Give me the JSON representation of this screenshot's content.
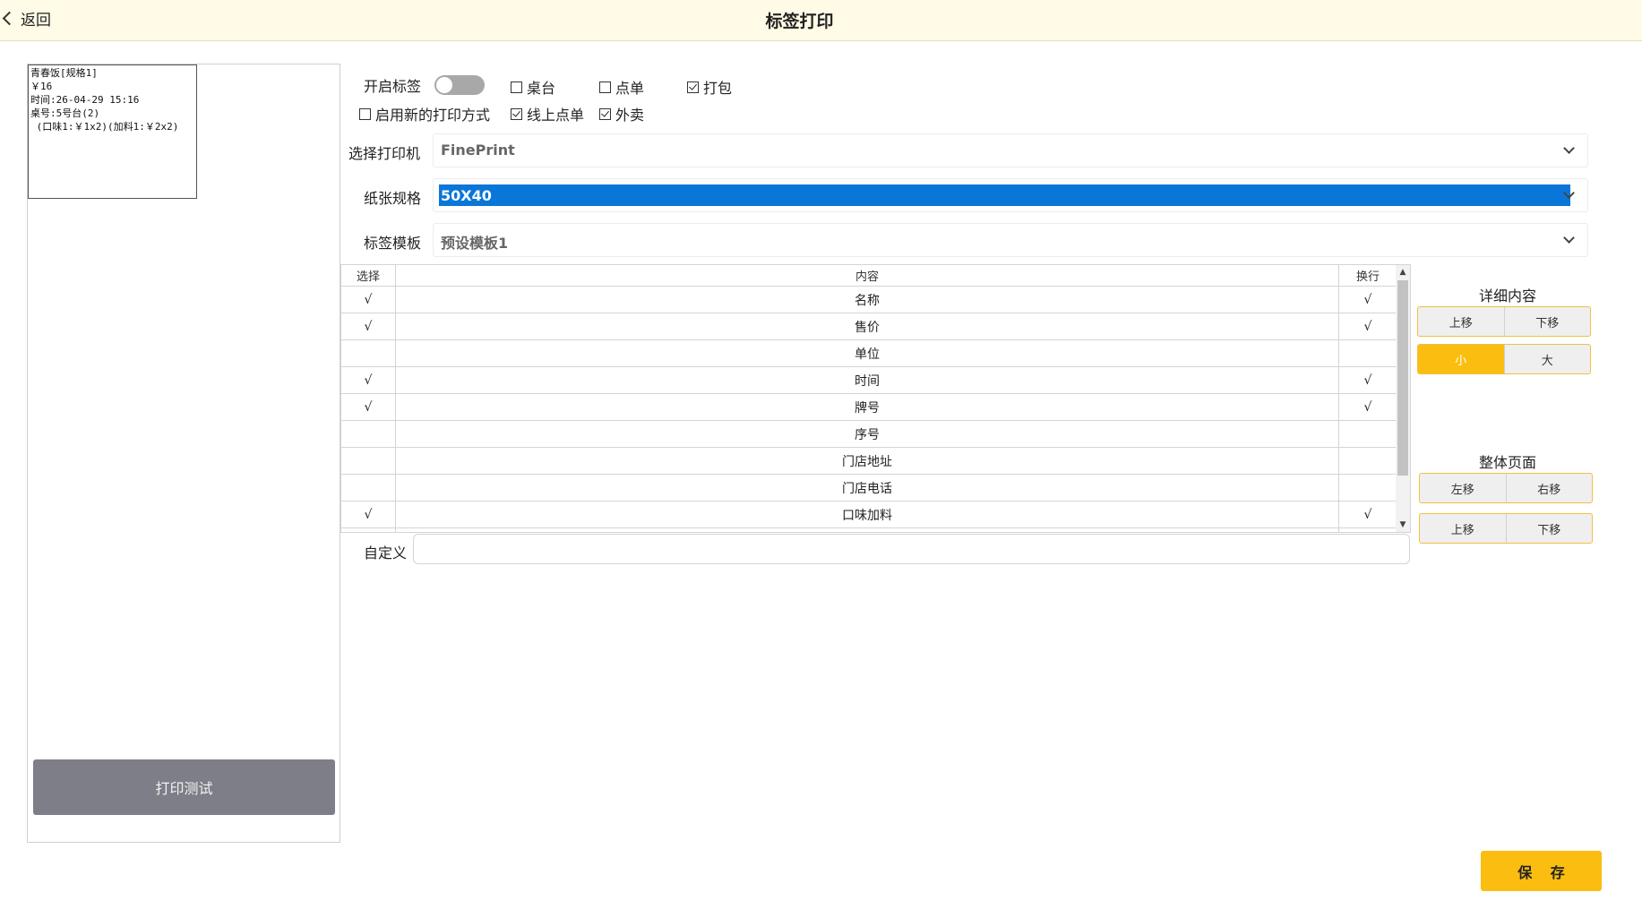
{
  "header": {
    "back_label": "返回",
    "title": "标签打印"
  },
  "preview": {
    "lines": [
      "青春饭[规格1]",
      "￥16",
      "时间:26-04-29 15:16",
      "桌号:5号台(2)",
      " (口味1:￥1x2)(加料1:￥2x2)"
    ]
  },
  "print_test_label": "打印测试",
  "options": {
    "enable_label": "开启标签",
    "enable_on": false,
    "table": {
      "label": "桌台",
      "checked": false
    },
    "order": {
      "label": "点单",
      "checked": false
    },
    "pack": {
      "label": "打包",
      "checked": true
    },
    "new_print": {
      "label": "启用新的打印方式",
      "checked": false
    },
    "online_order": {
      "label": "线上点单",
      "checked": true
    },
    "takeout": {
      "label": "外卖",
      "checked": true
    }
  },
  "printer": {
    "label": "选择打印机",
    "value": "FinePrint"
  },
  "paper": {
    "label": "纸张规格",
    "value": "50X40"
  },
  "template": {
    "label": "标签模板",
    "value": "预设模板1"
  },
  "table": {
    "headers": {
      "select": "选择",
      "content": "内容",
      "wrap": "换行"
    },
    "rows": [
      {
        "select": "√",
        "content": "名称",
        "wrap": "√"
      },
      {
        "select": "√",
        "content": "售价",
        "wrap": "√"
      },
      {
        "select": "",
        "content": "单位",
        "wrap": ""
      },
      {
        "select": "√",
        "content": "时间",
        "wrap": "√"
      },
      {
        "select": "√",
        "content": "牌号",
        "wrap": "√"
      },
      {
        "select": "",
        "content": "序号",
        "wrap": ""
      },
      {
        "select": "",
        "content": "门店地址",
        "wrap": ""
      },
      {
        "select": "",
        "content": "门店电话",
        "wrap": ""
      },
      {
        "select": "√",
        "content": "口味加料",
        "wrap": "√"
      },
      {
        "select": "",
        "content": "",
        "wrap": ""
      }
    ]
  },
  "custom": {
    "label": "自定义",
    "value": ""
  },
  "detail": {
    "title": "详细内容",
    "move_up": "上移",
    "move_down": "下移",
    "size_small": "小",
    "size_large": "大",
    "selected_size": "小"
  },
  "page": {
    "title": "整体页面",
    "move_left": "左移",
    "move_right": "右移",
    "move_up": "上移",
    "move_down": "下移"
  },
  "save_label": "保 存",
  "colors": {
    "accent": "#fbbd0f",
    "header_bg": "#fffbe6",
    "select_highlight": "#0a76d8",
    "print_button": "#7d7e87"
  }
}
